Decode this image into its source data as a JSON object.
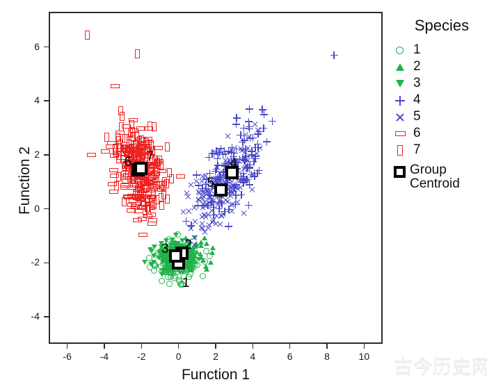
{
  "axes": {
    "xlabel": "Function 1",
    "ylabel": "Function 2",
    "xticks": [
      "-6",
      "-4",
      "-2",
      "0",
      "2",
      "4",
      "6",
      "8",
      "10"
    ],
    "yticks": [
      "6",
      "4",
      "2",
      "0",
      "-2",
      "-4"
    ]
  },
  "legend": {
    "title": "Species",
    "items": [
      {
        "label": "1",
        "icon": "circle-icon",
        "color": "#21b24b"
      },
      {
        "label": "2",
        "icon": "triangle-up-icon",
        "color": "#21b24b"
      },
      {
        "label": "3",
        "icon": "triangle-down-icon",
        "color": "#21b24b"
      },
      {
        "label": "4",
        "icon": "plus-icon",
        "color": "#4a48c8"
      },
      {
        "label": "5",
        "icon": "cross-x-icon",
        "color": "#4a48c8"
      },
      {
        "label": "6",
        "icon": "wide-rectangle-icon",
        "color": "#ee2222"
      },
      {
        "label": "7",
        "icon": "tall-rectangle-icon",
        "color": "#ee2222"
      }
    ],
    "centroid_label": "Group\nCentroid",
    "centroid_label_line1": "Group",
    "centroid_label_line2": "Centroid"
  },
  "watermark": {
    "text": "古今历史网"
  },
  "colors": {
    "green": "#21b24b",
    "blue": "#4a48c8",
    "red": "#ee2222",
    "axis": "#2b2b2b",
    "centroid": "#000000"
  },
  "chart_data": {
    "type": "scatter",
    "title": "",
    "xlabel": "Function 1",
    "ylabel": "Function 2",
    "xlim": [
      -7,
      11
    ],
    "ylim": [
      -5,
      7.3
    ],
    "grid": false,
    "legend_position": "right",
    "legend_title": "Species",
    "series": [
      {
        "name": "1",
        "marker": "circle",
        "color": "#21b24b",
        "n": 150,
        "cluster_center": [
          -0.1,
          -1.95
        ],
        "cluster_spread": [
          0.85,
          0.75
        ]
      },
      {
        "name": "2",
        "marker": "triangle-up",
        "color": "#21b24b",
        "n": 110,
        "cluster_center": [
          0.1,
          -1.6
        ],
        "cluster_spread": [
          0.8,
          0.7
        ]
      },
      {
        "name": "3",
        "marker": "triangle-down",
        "color": "#21b24b",
        "n": 110,
        "cluster_center": [
          -0.25,
          -1.7
        ],
        "cluster_spread": [
          0.8,
          0.7
        ]
      },
      {
        "name": "4",
        "marker": "plus",
        "color": "#4a48c8",
        "n": 150,
        "cluster_center": [
          2.8,
          1.4
        ],
        "cluster_spread": [
          1.5,
          1.3
        ]
      },
      {
        "name": "5",
        "marker": "cross-x",
        "color": "#4a48c8",
        "n": 150,
        "cluster_center": [
          2.2,
          0.75
        ],
        "cluster_spread": [
          1.5,
          1.2
        ]
      },
      {
        "name": "6",
        "marker": "wide-rectangle",
        "color": "#ee2222",
        "n": 170,
        "cluster_center": [
          -2.25,
          1.5
        ],
        "cluster_spread": [
          1.1,
          1.35
        ]
      },
      {
        "name": "7",
        "marker": "tall-rectangle",
        "color": "#ee2222",
        "n": 170,
        "cluster_center": [
          -2.1,
          1.55
        ],
        "cluster_spread": [
          1.1,
          1.35
        ]
      }
    ],
    "centroids": [
      {
        "label": "1",
        "x": -0.1,
        "y": -1.95,
        "label_dx": 6,
        "label_dy": 20
      },
      {
        "label": "2",
        "x": 0.1,
        "y": -1.6,
        "label_dx": 4,
        "label_dy": -22
      },
      {
        "label": "3",
        "x": -0.25,
        "y": -1.7,
        "label_dx": -20,
        "label_dy": -20
      },
      {
        "label": "4",
        "x": 2.8,
        "y": 1.4,
        "label_dx": -3,
        "label_dy": -22
      },
      {
        "label": "5",
        "x": 2.2,
        "y": 0.75,
        "label_dx": -20,
        "label_dy": -20
      },
      {
        "label": "6",
        "x": -2.25,
        "y": 1.5,
        "label_dx": -20,
        "label_dy": -20
      },
      {
        "label": "7",
        "x": -2.1,
        "y": 1.55,
        "label_dx": 8,
        "label_dy": -26
      }
    ],
    "notable_outliers": [
      {
        "series": "7",
        "x": -5.0,
        "y": 6.5
      },
      {
        "series": "4",
        "x": 8.3,
        "y": 5.75
      },
      {
        "series": "6",
        "x": -3.5,
        "y": 4.6
      },
      {
        "series": "7",
        "x": -2.3,
        "y": 5.8
      }
    ]
  }
}
